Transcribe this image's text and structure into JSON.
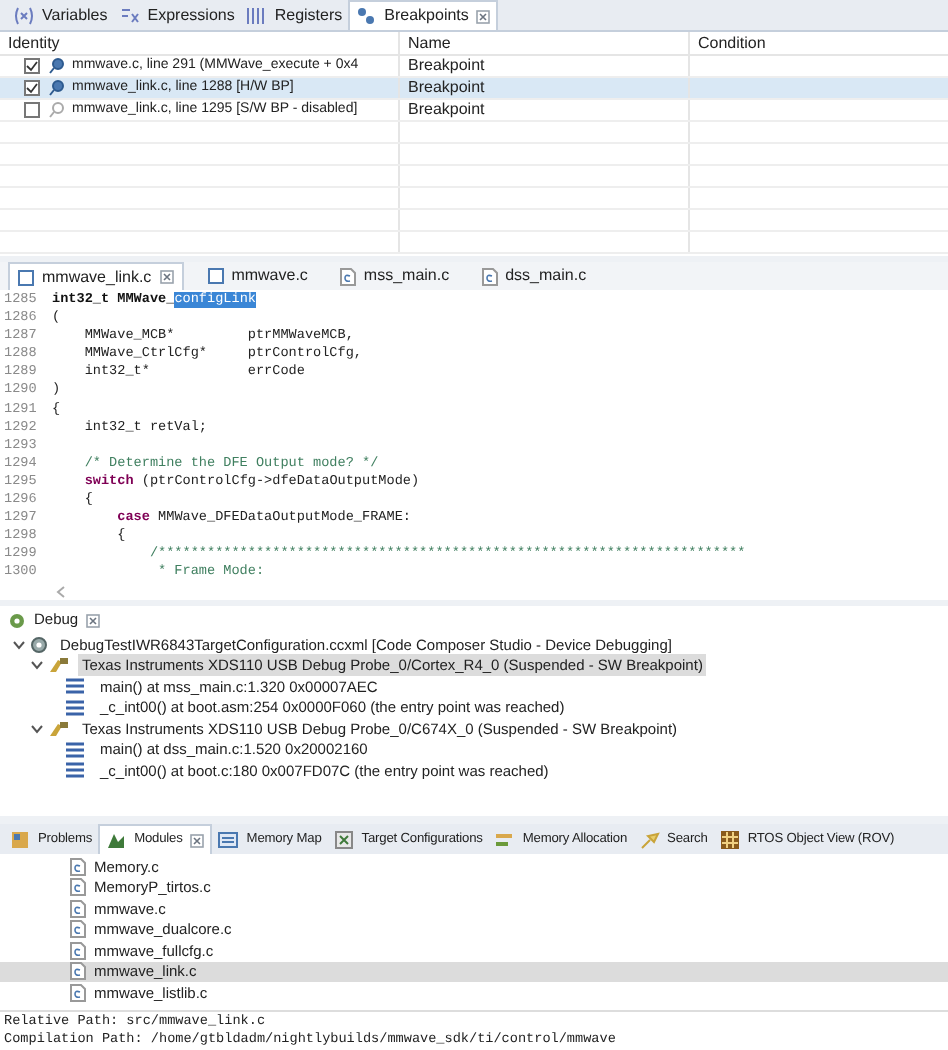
{
  "top_tabs": [
    {
      "label": "Variables",
      "selected": false
    },
    {
      "label": "Expressions",
      "selected": false
    },
    {
      "label": "Registers",
      "selected": false
    },
    {
      "label": "Breakpoints",
      "selected": true
    }
  ],
  "breakpoints": {
    "columns": [
      "Identity",
      "Name",
      "Condition"
    ],
    "rows": [
      {
        "identity": "mmwave.c, line 291 (MMWave_execute + 0x4",
        "name": "Breakpoint",
        "checked": true,
        "selected": false
      },
      {
        "identity": "mmwave_link.c, line 1288 [H/W BP]",
        "name": "Breakpoint",
        "checked": true,
        "selected": true
      },
      {
        "identity": "mmwave_link.c, line 1295 [S/W BP - disabled]",
        "name": "Breakpoint",
        "checked": false,
        "selected": false
      }
    ]
  },
  "editor_tabs": [
    {
      "label": "mmwave_link.c",
      "kind": "editor",
      "selected": true
    },
    {
      "label": "mmwave.c",
      "kind": "editor",
      "selected": false
    },
    {
      "label": "mss_main.c",
      "kind": "source",
      "selected": false
    },
    {
      "label": "dss_main.c",
      "kind": "source",
      "selected": false
    }
  ],
  "code": [
    {
      "number": "1285",
      "tokens": [
        {
          "text": "int32_t MMWave_",
          "kind": "strong"
        },
        {
          "text": "configLink",
          "kind": "selected"
        }
      ]
    },
    {
      "number": "1286",
      "tokens": [
        {
          "text": "(",
          "kind": "plain"
        }
      ]
    },
    {
      "number": "1287",
      "tokens": [
        {
          "text": "    MMWave_MCB*         ptrMMWaveMCB,",
          "kind": "plain"
        }
      ]
    },
    {
      "number": "1288",
      "tokens": [
        {
          "text": "    MMWave_CtrlCfg*     ptrControlCfg,",
          "kind": "plain"
        }
      ]
    },
    {
      "number": "1289",
      "tokens": [
        {
          "text": "    int32_t*            errCode",
          "kind": "plain"
        }
      ]
    },
    {
      "number": "1290",
      "tokens": [
        {
          "text": ")",
          "kind": "plain"
        }
      ]
    },
    {
      "number": "1291",
      "tokens": [
        {
          "text": "{",
          "kind": "plain"
        }
      ]
    },
    {
      "number": "1292",
      "tokens": [
        {
          "text": "    int32_t retVal;",
          "kind": "plain"
        }
      ]
    },
    {
      "number": "1293"
    },
    {
      "number": "1294",
      "tokens": [
        {
          "text": "    /* Determine the DFE Output mode? */",
          "kind": "comment"
        }
      ]
    },
    {
      "number": "1295",
      "tokens": [
        {
          "text": "    switch",
          "kind": "keyword"
        },
        {
          "text": " (ptrControlCfg->dfeDataOutputMode)",
          "kind": "plain"
        }
      ]
    },
    {
      "number": "1296",
      "tokens": [
        {
          "text": "    {",
          "kind": "plain"
        }
      ]
    },
    {
      "number": "1297",
      "tokens": [
        {
          "text": "        case",
          "kind": "keyword"
        },
        {
          "text": " MMWave_DFEDataOutputMode_FRAME:",
          "kind": "plain"
        }
      ]
    },
    {
      "number": "1298",
      "tokens": [
        {
          "text": "        {",
          "kind": "plain"
        }
      ]
    },
    {
      "number": "1299",
      "tokens": [
        {
          "text": "            /************************************************************************",
          "kind": "comment"
        }
      ]
    },
    {
      "number": "1300",
      "tokens": [
        {
          "text": "             * Frame Mode:",
          "kind": "comment"
        }
      ]
    }
  ],
  "debug": {
    "title": "Debug",
    "tree": [
      {
        "label": "DebugTestIWR6843TargetConfiguration.ccxml [Code Composer Studio - Device Debugging]",
        "kind": "session",
        "expanded": true,
        "selected": false,
        "children": [
          {
            "label": "Texas Instruments XDS110 USB Debug Probe_0/Cortex_R4_0 (Suspended - SW Breakpoint)",
            "kind": "core",
            "expanded": true,
            "selected": true,
            "children": [
              {
                "label": "main() at mss_main.c:1.320 0x00007AEC",
                "kind": "frame",
                "selected": false
              },
              {
                "label": "_c_int00() at boot.asm:254 0x0000F060  (the entry point was reached)",
                "kind": "frame",
                "selected": false
              }
            ]
          },
          {
            "label": "Texas Instruments XDS110 USB Debug Probe_0/C674X_0 (Suspended - SW Breakpoint)",
            "kind": "core",
            "expanded": true,
            "selected": false,
            "children": [
              {
                "label": "main() at dss_main.c:1.520 0x20002160",
                "kind": "frame",
                "selected": false
              },
              {
                "label": "_c_int00() at boot.c:180 0x007FD07C  (the entry point was reached)",
                "kind": "frame",
                "selected": false
              }
            ]
          }
        ]
      }
    ]
  },
  "bottom_tabs": [
    {
      "label": "Problems",
      "selected": false
    },
    {
      "label": "Modules",
      "selected": true
    },
    {
      "label": "Memory Map",
      "selected": false
    },
    {
      "label": "Target Configurations",
      "selected": false
    },
    {
      "label": "Memory Allocation",
      "selected": false
    },
    {
      "label": "Search",
      "selected": false
    },
    {
      "label": "RTOS Object View (ROV)",
      "selected": false
    }
  ],
  "modules": [
    {
      "label": "Memory.c",
      "selected": false
    },
    {
      "label": "MemoryP_tirtos.c",
      "selected": false
    },
    {
      "label": "mmwave.c",
      "selected": false
    },
    {
      "label": "mmwave_dualcore.c",
      "selected": false
    },
    {
      "label": "mmwave_fullcfg.c",
      "selected": false
    },
    {
      "label": "mmwave_link.c",
      "selected": true
    },
    {
      "label": "mmwave_listlib.c",
      "selected": false
    }
  ],
  "paths": [
    "Relative Path: src/mmwave_link.c",
    "Compilation Path: /home/gtbldadm/nightlybuilds/mmwave_sdk/ti/control/mmwave"
  ]
}
